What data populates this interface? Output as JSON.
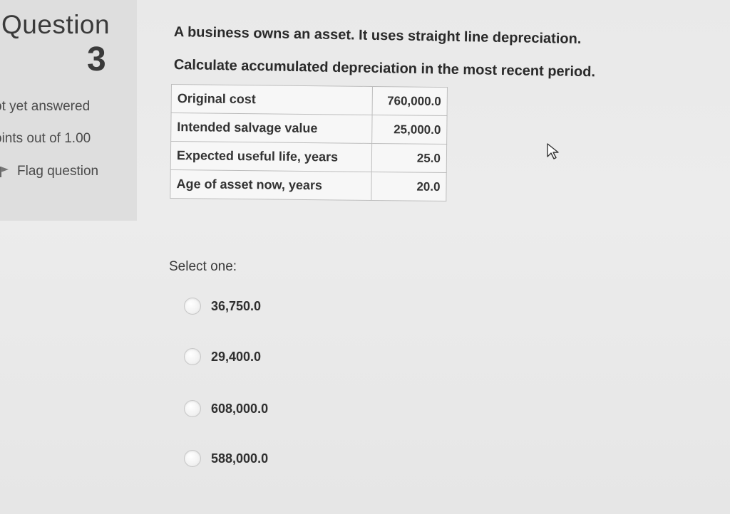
{
  "question_info": {
    "title": "Question",
    "number": "3",
    "status": "ot yet answered",
    "marks": "oints out of 1.00",
    "flag_label": "Flag question"
  },
  "question": {
    "line1": "A business owns an asset. It uses straight line depreciation.",
    "line2": "Calculate accumulated depreciation in the most recent period.",
    "table": [
      {
        "label": "Original cost",
        "value": "760,000.0"
      },
      {
        "label": "Intended salvage value",
        "value": "25,000.0"
      },
      {
        "label": "Expected useful life, years",
        "value": "25.0"
      },
      {
        "label": "Age of asset now, years",
        "value": "20.0"
      }
    ]
  },
  "answer": {
    "prompt": "Select one:",
    "options": [
      {
        "label": "36,750.0"
      },
      {
        "label": "29,400.0"
      },
      {
        "label": "608,000.0"
      },
      {
        "label": "588,000.0"
      }
    ]
  },
  "icons": {
    "flag": "flag-icon",
    "pointer": "mouse-pointer-icon",
    "radio": "radio-button"
  }
}
